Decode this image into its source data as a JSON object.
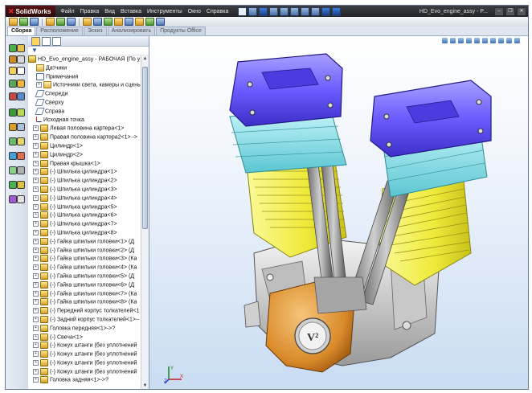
{
  "app": {
    "name": "SolidWorks",
    "document_title": "HD_Evo_engine_assy - P..."
  },
  "menu": [
    "Файл",
    "Правка",
    "Вид",
    "Вставка",
    "Инструменты",
    "Окно",
    "Справка"
  ],
  "command_tabs": [
    "Сборка",
    "Расположение",
    "Эскиз",
    "Анализировать",
    "Продукты Office"
  ],
  "feature_tree": {
    "root": "HD_Evo_engine_assy - РАБОЧАЯ (По у",
    "items": [
      {
        "label": "Датчики",
        "icon": "sensor-folder-icon"
      },
      {
        "label": "Примечания",
        "icon": "annotation-icon"
      },
      {
        "label": "Источники света, камеры и сцены",
        "icon": "lights-folder-icon"
      },
      {
        "label": "Спереди",
        "icon": "plane-icon"
      },
      {
        "label": "Сверху",
        "icon": "plane-icon"
      },
      {
        "label": "Справа",
        "icon": "plane-icon"
      },
      {
        "label": "Исходная точка",
        "icon": "origin-icon"
      },
      {
        "label": "Левая половина картера<1>",
        "icon": "part-icon"
      },
      {
        "label": "Правая половина картера2<1> ->",
        "icon": "part-icon"
      },
      {
        "label": "Цилиндр<1>",
        "icon": "part-icon"
      },
      {
        "label": "Цилиндр<2>",
        "icon": "part-icon"
      },
      {
        "label": "Правая крышка<1>",
        "icon": "part-icon"
      },
      {
        "label": "(-) Шпилька цилиндра<1>",
        "icon": "part-icon"
      },
      {
        "label": "(-) Шпилька цилиндра<2>",
        "icon": "part-icon"
      },
      {
        "label": "(-) Шпилька цилиндра<3>",
        "icon": "part-icon"
      },
      {
        "label": "(-) Шпилька цилиндра<4>",
        "icon": "part-icon"
      },
      {
        "label": "(-) Шпилька цилиндра<5>",
        "icon": "part-icon"
      },
      {
        "label": "(-) Шпилька цилиндра<6>",
        "icon": "part-icon"
      },
      {
        "label": "(-) Шпилька цилиндра<7>",
        "icon": "part-icon"
      },
      {
        "label": "(-) Шпилька цилиндра<8>",
        "icon": "part-icon"
      },
      {
        "label": "(-) Гайка шпильки головки<1> (Д",
        "icon": "part-icon"
      },
      {
        "label": "(-) Гайка шпильки головки<2> (Д",
        "icon": "part-icon"
      },
      {
        "label": "(-) Гайка шпильки головки<3> (Ка",
        "icon": "part-icon"
      },
      {
        "label": "(-) Гайка шпильки головки<4> (Ка",
        "icon": "part-icon"
      },
      {
        "label": "(-) Гайка шпильки головки<5> (Д",
        "icon": "part-icon"
      },
      {
        "label": "(-) Гайка шпильки головки<6> (Д",
        "icon": "part-icon"
      },
      {
        "label": "(-) Гайка шпильки головки<7> (Ка",
        "icon": "part-icon"
      },
      {
        "label": "(-) Гайка шпильки головки<8> (Ка",
        "icon": "part-icon"
      },
      {
        "label": "(-) Передний корпус толкателей<1",
        "icon": "part-icon"
      },
      {
        "label": "(-) Задний корпус толкателей<1>--",
        "icon": "part-icon"
      },
      {
        "label": "Головка передняя<1>->?",
        "icon": "asm-icon"
      },
      {
        "label": "(-) Свеча<1>",
        "icon": "part-icon"
      },
      {
        "label": "(-) Кожух штанги (без уплотнений",
        "icon": "part-icon"
      },
      {
        "label": "(-) Кожух штанги (без уплотнений",
        "icon": "part-icon"
      },
      {
        "label": "(-) Кожух штанги (без уплотнений",
        "icon": "part-icon"
      },
      {
        "label": "(-) Кожух штанги (без уплотнений",
        "icon": "part-icon"
      },
      {
        "label": "Головка задняя<1>->?",
        "icon": "asm-icon"
      }
    ]
  },
  "viewport": {
    "model": "V-twin engine assembly",
    "badge_text": "V²",
    "colors": {
      "valve_cover": "#6a5cff",
      "rocker_box": "#7fe0e8",
      "cylinder": "#f2f04a",
      "crankcase": "#e0e0e0",
      "cam_cover": "#d98a2a"
    },
    "triad_axes": [
      "X",
      "Y",
      "Z"
    ]
  }
}
